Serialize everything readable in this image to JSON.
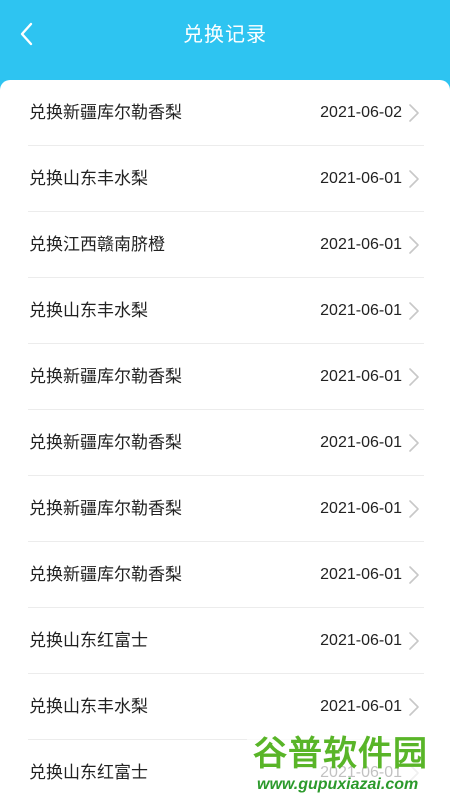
{
  "header": {
    "title": "兑换记录",
    "back_icon": "chevron-left-icon"
  },
  "colors": {
    "header_bg": "#2ec4f1",
    "card_bg": "#ffffff",
    "divider": "#ececec",
    "text": "#222222",
    "chevron": "#c8c8c8"
  },
  "records": [
    {
      "label": "兑换新疆库尔勒香梨",
      "date": "2021-06-02"
    },
    {
      "label": "兑换山东丰水梨",
      "date": "2021-06-01"
    },
    {
      "label": "兑换江西赣南脐橙",
      "date": "2021-06-01"
    },
    {
      "label": "兑换山东丰水梨",
      "date": "2021-06-01"
    },
    {
      "label": "兑换新疆库尔勒香梨",
      "date": "2021-06-01"
    },
    {
      "label": "兑换新疆库尔勒香梨",
      "date": "2021-06-01"
    },
    {
      "label": "兑换新疆库尔勒香梨",
      "date": "2021-06-01"
    },
    {
      "label": "兑换新疆库尔勒香梨",
      "date": "2021-06-01"
    },
    {
      "label": "兑换山东红富士",
      "date": "2021-06-01"
    },
    {
      "label": "兑换山东丰水梨",
      "date": "2021-06-01"
    },
    {
      "label": "兑换山东红富士",
      "date": "2021-06-01"
    }
  ],
  "watermark": {
    "logo_text": "谷普软件园",
    "url": "www.gupuxiazai.com"
  }
}
